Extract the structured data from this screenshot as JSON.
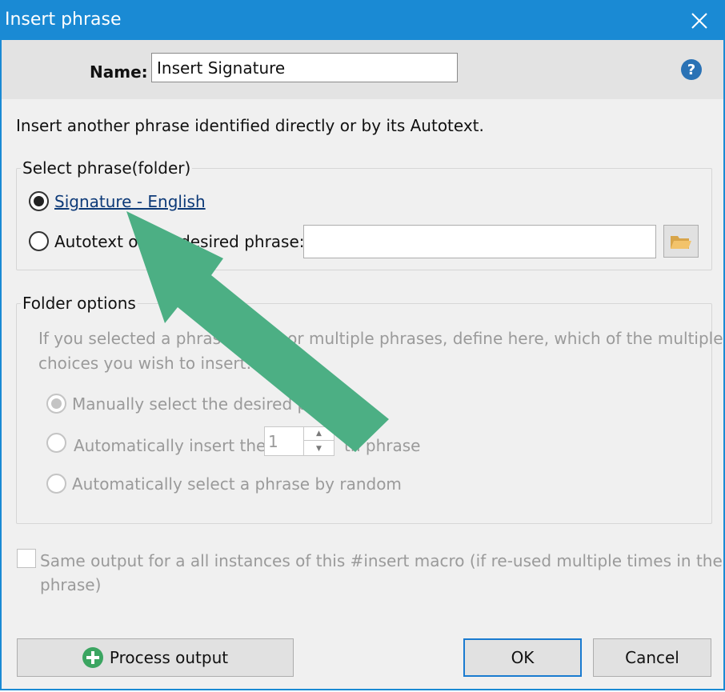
{
  "window": {
    "title": "Insert phrase"
  },
  "header": {
    "name_label": "Name:",
    "name_value": "Insert Signature"
  },
  "description": "Insert another phrase identified directly or by its Autotext.",
  "select_phrase": {
    "group_title": "Select phrase(folder)",
    "option_direct": {
      "label": "Signature - English",
      "checked": true
    },
    "option_autotext": {
      "label": "Autotext of the desired phrase:",
      "value": ""
    }
  },
  "folder_options": {
    "group_title": "Folder options",
    "hint_line1": "If you selected a phrase folder or multiple phrases, define here, which of the multiple",
    "hint_line2": "choices you wish to insert:",
    "option_manual": "Manually select the desired phrase",
    "option_auto_prefix": "Automatically insert the",
    "option_auto_number": "1",
    "option_auto_suffix": "th phrase",
    "option_random": "Automatically select a phrase by random"
  },
  "same_output": {
    "line1": "Same output for a all instances of this #insert macro (if re-used multiple times in the",
    "line2": "phrase)"
  },
  "buttons": {
    "process_output": "Process output",
    "ok": "OK",
    "cancel": "Cancel"
  },
  "colors": {
    "titlebar": "#1a8ad4",
    "arrow": "#4caf84",
    "help": "#2a72b5"
  },
  "icons": [
    "close-icon",
    "help-icon",
    "folder-icon",
    "plus-icon"
  ]
}
